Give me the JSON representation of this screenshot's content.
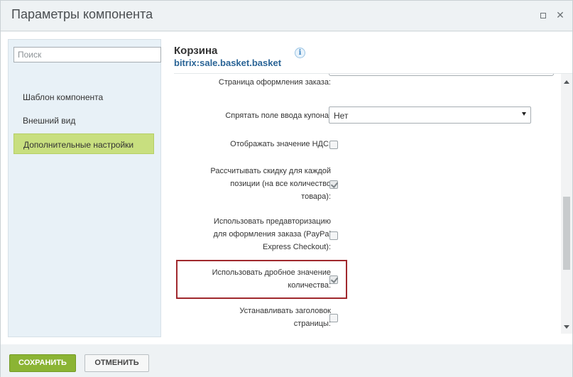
{
  "window": {
    "title": "Параметры компонента"
  },
  "sidebar": {
    "search_placeholder": "Поиск",
    "items": [
      {
        "label": "Шаблон компонента",
        "active": false
      },
      {
        "label": "Внешний вид",
        "active": false
      },
      {
        "label": "Дополнительные настройки",
        "active": true
      }
    ]
  },
  "component": {
    "title": "Корзина",
    "code": "bitrix:sale.basket.basket",
    "info_icon_glyph": "i"
  },
  "settings": [
    {
      "label_lines": [
        "Страница оформления заказа:"
      ],
      "control": "text",
      "value": ""
    },
    {
      "label_lines": [
        "Спрятать поле ввода купона:"
      ],
      "control": "select",
      "value": "Нет"
    },
    {
      "label_lines": [
        "Отображать значение НДС:"
      ],
      "control": "checkbox",
      "checked": false
    },
    {
      "label_lines": [
        "Рассчитывать скидку для каждой",
        "позиции (на все количество",
        "товара):"
      ],
      "control": "checkbox",
      "checked": true
    },
    {
      "label_lines": [
        "Использовать предавторизацию",
        "для оформления заказа (PayPal",
        "Express Checkout):"
      ],
      "control": "checkbox",
      "checked": false
    },
    {
      "label_lines": [
        "Использовать дробное значение",
        "количества:"
      ],
      "control": "checkbox",
      "checked": true,
      "highlighted": true
    },
    {
      "label_lines": [
        "Устанавливать заголовок",
        "страницы:"
      ],
      "control": "checkbox",
      "checked": false
    }
  ],
  "footer": {
    "save_label": "СОХРАНИТЬ",
    "cancel_label": "ОТМЕНИТЬ"
  },
  "colors": {
    "accent_green": "#8bb434",
    "active_item": "#c8df7f",
    "highlight_border": "#a0282d",
    "link_blue": "#2a6496"
  }
}
